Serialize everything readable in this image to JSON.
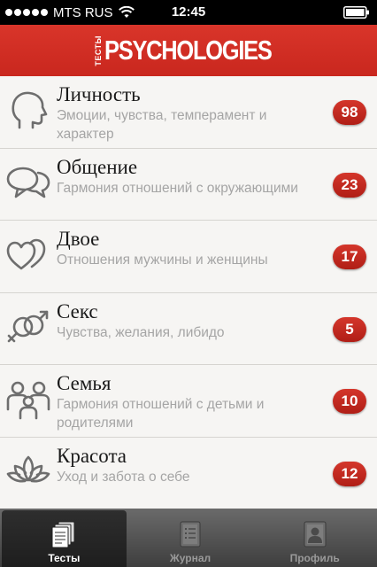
{
  "status_bar": {
    "carrier": "MTS RUS",
    "time": "12:45"
  },
  "header": {
    "logo_small": "ТЕСТЫ",
    "logo_main": "PSYCHOLOGIES"
  },
  "categories": [
    {
      "title": "Личность",
      "description": "Эмоции, чувства, темперамент и характер",
      "count": "98",
      "icon": "head-icon"
    },
    {
      "title": "Общение",
      "description": "Гармония отношений с окружающими",
      "count": "23",
      "icon": "speech-bubbles-icon"
    },
    {
      "title": "Двое",
      "description": "Отношения мужчины и женщины",
      "count": "17",
      "icon": "two-hearts-icon"
    },
    {
      "title": "Секс",
      "description": "Чувства, желания, либидо",
      "count": "5",
      "icon": "gender-symbols-icon"
    },
    {
      "title": "Семья",
      "description": "Гармония отношений с детьми и родителями",
      "count": "10",
      "icon": "family-icon"
    },
    {
      "title": "Красота",
      "description": "Уход и забота о себе",
      "count": "12",
      "icon": "lotus-icon"
    }
  ],
  "tabs": [
    {
      "label": "Тесты",
      "icon": "tests-icon",
      "active": true
    },
    {
      "label": "Журнал",
      "icon": "journal-icon",
      "active": false
    },
    {
      "label": "Профиль",
      "icon": "profile-icon",
      "active": false
    }
  ],
  "colors": {
    "header_red": "#c9271e",
    "badge_red": "#c02a20",
    "icon_gray": "#6e6e6e"
  }
}
